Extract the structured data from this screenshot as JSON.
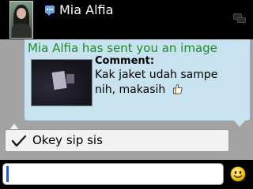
{
  "header": {
    "contact_name": "Mia Alfia",
    "icons": {
      "status": "bbm-chat-icon",
      "action": "chat-bubbles-icon"
    }
  },
  "incoming": {
    "notice": "Mia Alfia has sent you an image",
    "comment_label": "Comment:",
    "comment_line1": "Kak jaket udah sampe",
    "comment_line2": "nih, makasih",
    "emoticon": "thumbs-up-icon"
  },
  "outgoing": {
    "message": "Okey sip sis",
    "status_icon": "checkmark-icon"
  },
  "composer": {
    "value": "",
    "emoticon_button": "smiley-icon"
  },
  "colors": {
    "background": "#a3a3a3",
    "incoming_bubble": "#c9e2ef",
    "notice_text": "#1e8a2e",
    "outgoing_bubble": "#f2f2f2",
    "bar": "#000000"
  }
}
